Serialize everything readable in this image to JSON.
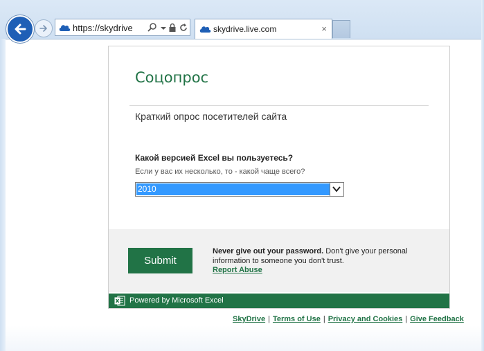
{
  "browser": {
    "address_url": "https://skydrive.li",
    "tab_title": "skydrive.live.com",
    "tab_close": "×",
    "back_icon": "back-arrow-icon",
    "forward_icon": "forward-arrow-icon"
  },
  "survey": {
    "title": "Соцопрос",
    "description": "Краткий опрос посетителей сайта",
    "question": "Какой версией Excel вы пользуетесь?",
    "hint": "Если у вас их несколько, то - какой чаще всего?",
    "selected_option": "2010"
  },
  "submit": {
    "button_label": "Submit",
    "warning_bold": "Never give out your password.",
    "warning_text": " Don't give your personal information to someone you don't trust.",
    "report_link": "Report Abuse"
  },
  "excel_bar": {
    "label": "Powered by Microsoft Excel"
  },
  "footer": {
    "links": [
      "SkyDrive",
      "Terms of Use",
      "Privacy and Cookies",
      "Give Feedback"
    ],
    "separator": "|"
  },
  "colors": {
    "excel_green": "#217346",
    "selection_blue": "#3399ff",
    "chrome_blue": "#1e5fb6"
  }
}
